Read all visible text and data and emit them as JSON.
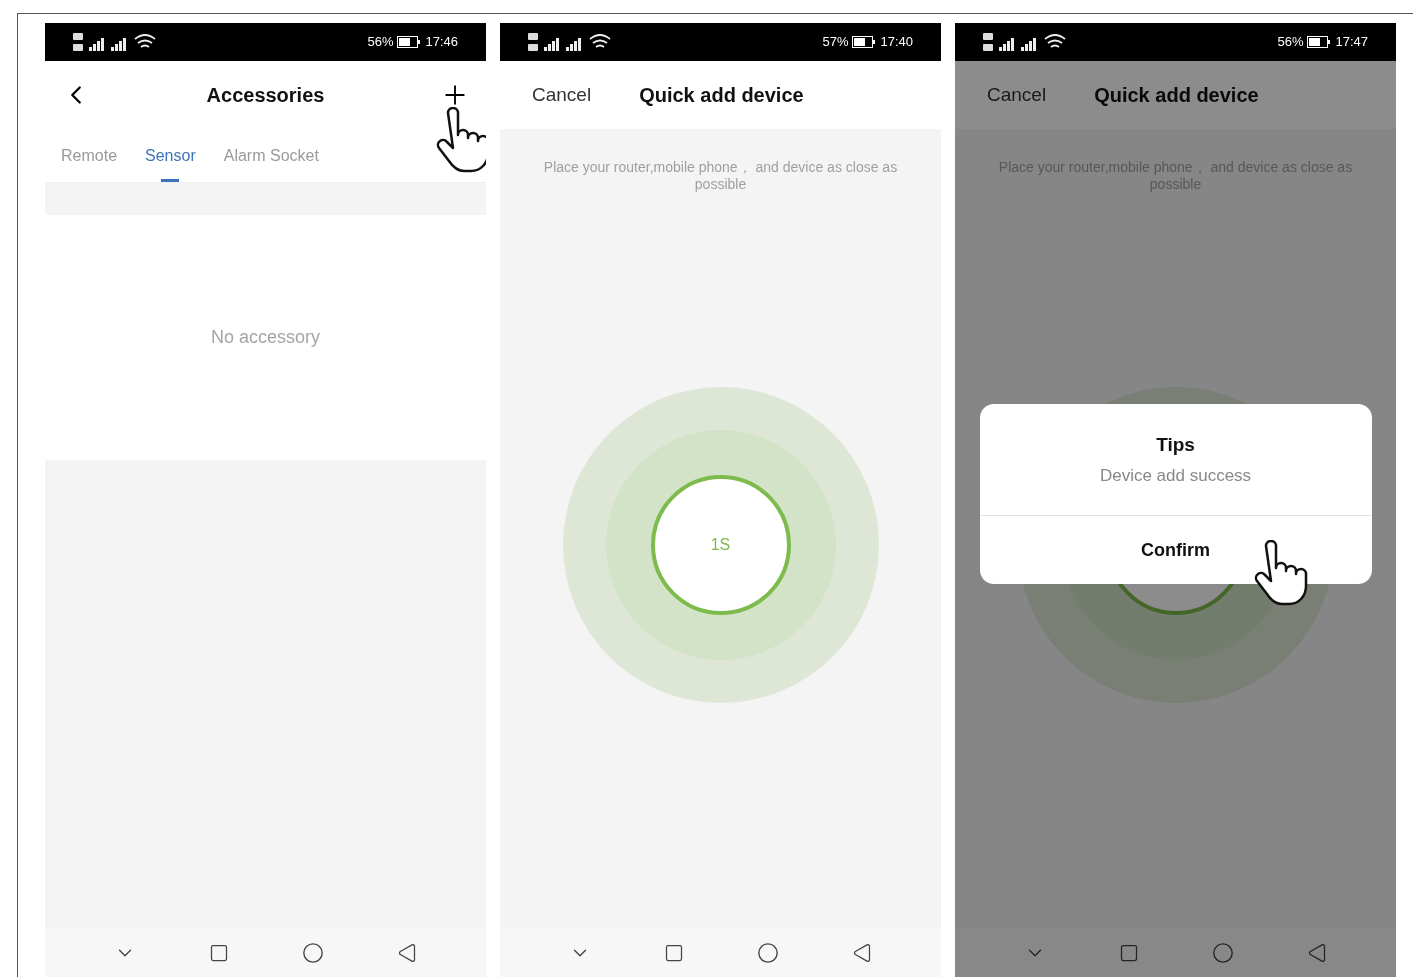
{
  "screens": [
    {
      "kind": "accessories",
      "status": {
        "battery": "56%",
        "time": "17:46"
      },
      "title": "Accessories",
      "tabs": [
        {
          "label": "Remote",
          "selected": false
        },
        {
          "label": "Sensor",
          "selected": true
        },
        {
          "label": "Alarm Socket",
          "selected": false
        }
      ],
      "empty_text": "No accessory"
    },
    {
      "kind": "quick_add",
      "status": {
        "battery": "57%",
        "time": "17:40"
      },
      "cancel": "Cancel",
      "title": "Quick add device",
      "hint": "Place your router,mobile phone， and device as close as possible",
      "countdown": "1S"
    },
    {
      "kind": "quick_add",
      "status": {
        "battery": "56%",
        "time": "17:47"
      },
      "cancel": "Cancel",
      "title": "Quick add device",
      "hint": "Place your router,mobile phone， and device as close as possible",
      "dialog": {
        "title": "Tips",
        "message": "Device add success",
        "button": "Confirm"
      }
    }
  ]
}
